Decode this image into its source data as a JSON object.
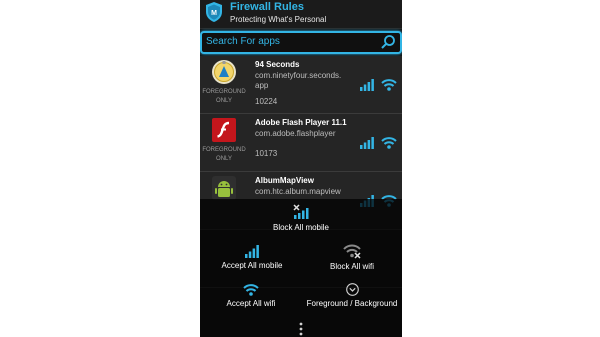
{
  "header": {
    "title": "Firewall Rules",
    "subtitle": "Protecting What's Personal",
    "accent": "#33b5e5"
  },
  "search": {
    "placeholder": "Search For apps"
  },
  "apps": [
    {
      "name": "94 Seconds",
      "package": "com.ninetyfour.seconds.\napp",
      "uid": "10224",
      "mode": "FOREGROUND ONLY",
      "icon": "94-seconds-app-icon"
    },
    {
      "name": "Adobe Flash Player 11.1",
      "package": "com.adobe.flashplayer",
      "uid": "10173",
      "mode": "FOREGROUND ONLY",
      "icon": "flash-player-app-icon"
    },
    {
      "name": "AlbumMapView",
      "package": "com.htc.album.mapview",
      "uid": "",
      "mode": "",
      "icon": "android-app-icon"
    }
  ],
  "menu": {
    "block_all_mobile": "Block All mobile",
    "accept_all_mobile": "Accept All mobile",
    "block_all_wifi": "Block All wifi",
    "accept_all_wifi": "Accept All wifi",
    "foreground_background": "Foreground / Background"
  },
  "icons": {
    "signal": "mobile-signal-icon",
    "wifi": "wifi-icon",
    "more": "overflow-menu-icon"
  }
}
